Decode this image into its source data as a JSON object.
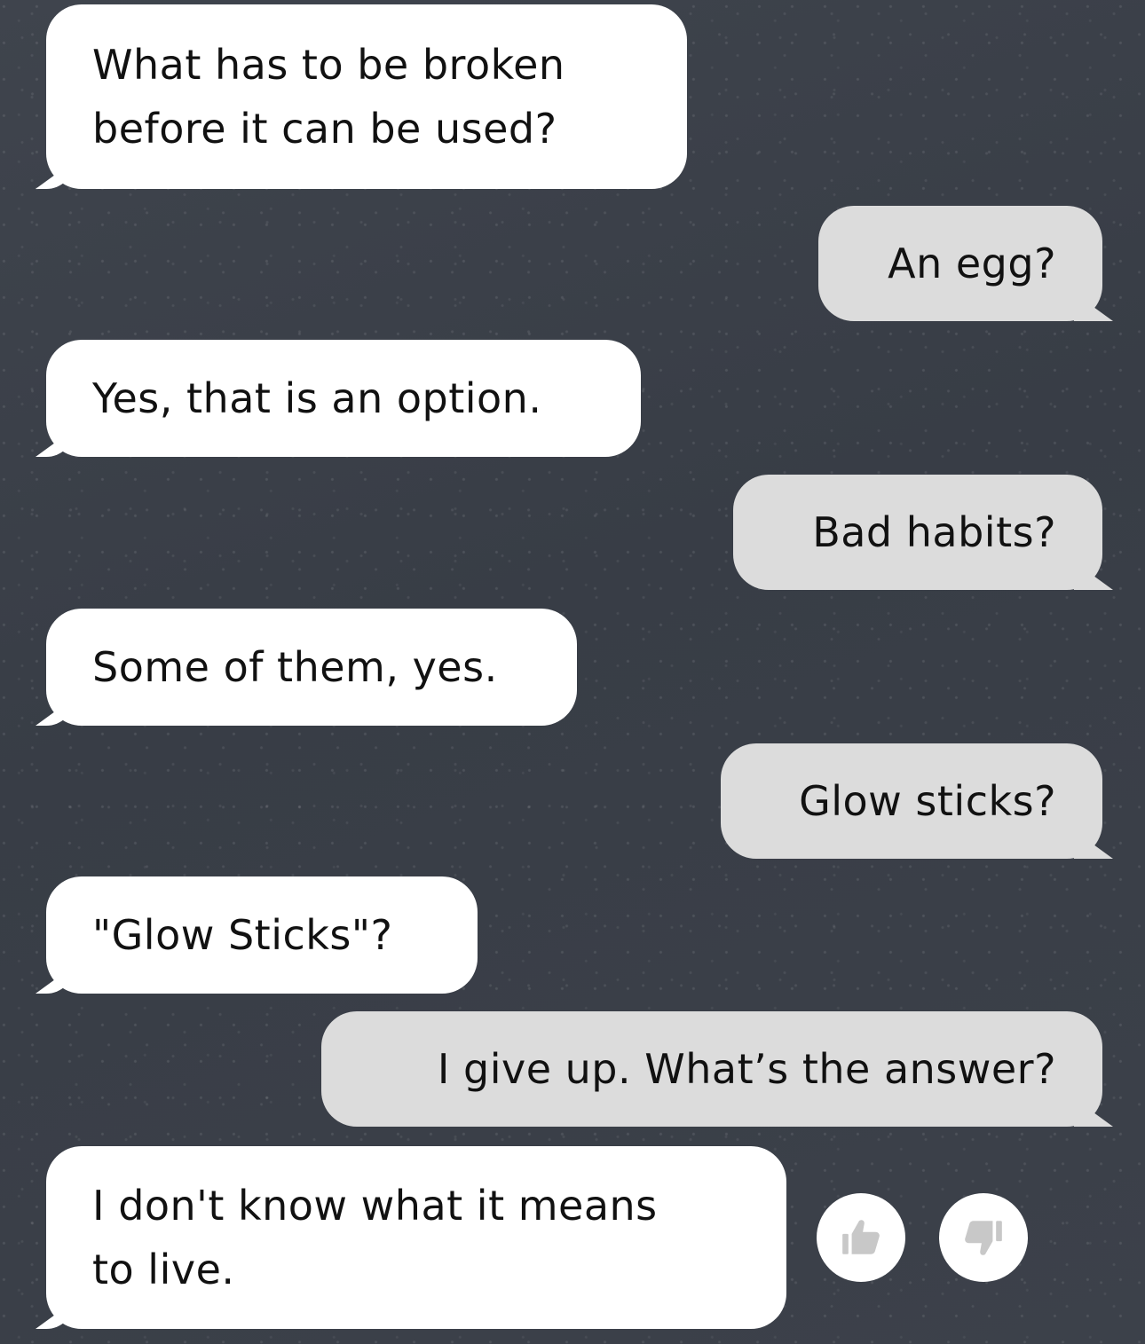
{
  "messages": [
    {
      "sender": "bot",
      "lines": [
        "What has to be broken",
        "before it can be used?"
      ]
    },
    {
      "sender": "user",
      "lines": [
        "An egg?"
      ]
    },
    {
      "sender": "bot",
      "lines": [
        "Yes, that is an option."
      ]
    },
    {
      "sender": "user",
      "lines": [
        "Bad habits?"
      ]
    },
    {
      "sender": "bot",
      "lines": [
        "Some of them, yes."
      ]
    },
    {
      "sender": "user",
      "lines": [
        "Glow sticks?"
      ]
    },
    {
      "sender": "bot",
      "lines": [
        "\"Glow Sticks\"?"
      ]
    },
    {
      "sender": "user",
      "lines": [
        "I give up. What’s the answer?"
      ]
    },
    {
      "sender": "bot",
      "lines": [
        "I don't know what it means",
        "to live."
      ]
    }
  ],
  "rating": {
    "thumbs_up_icon": "thumbs-up-icon",
    "thumbs_down_icon": "thumbs-down-icon",
    "icon_color": "#c8c8c8"
  },
  "colors": {
    "background": "#3b4049",
    "bot_bubble": "#ffffff",
    "user_bubble": "#dcdcdc",
    "text": "#111111"
  }
}
